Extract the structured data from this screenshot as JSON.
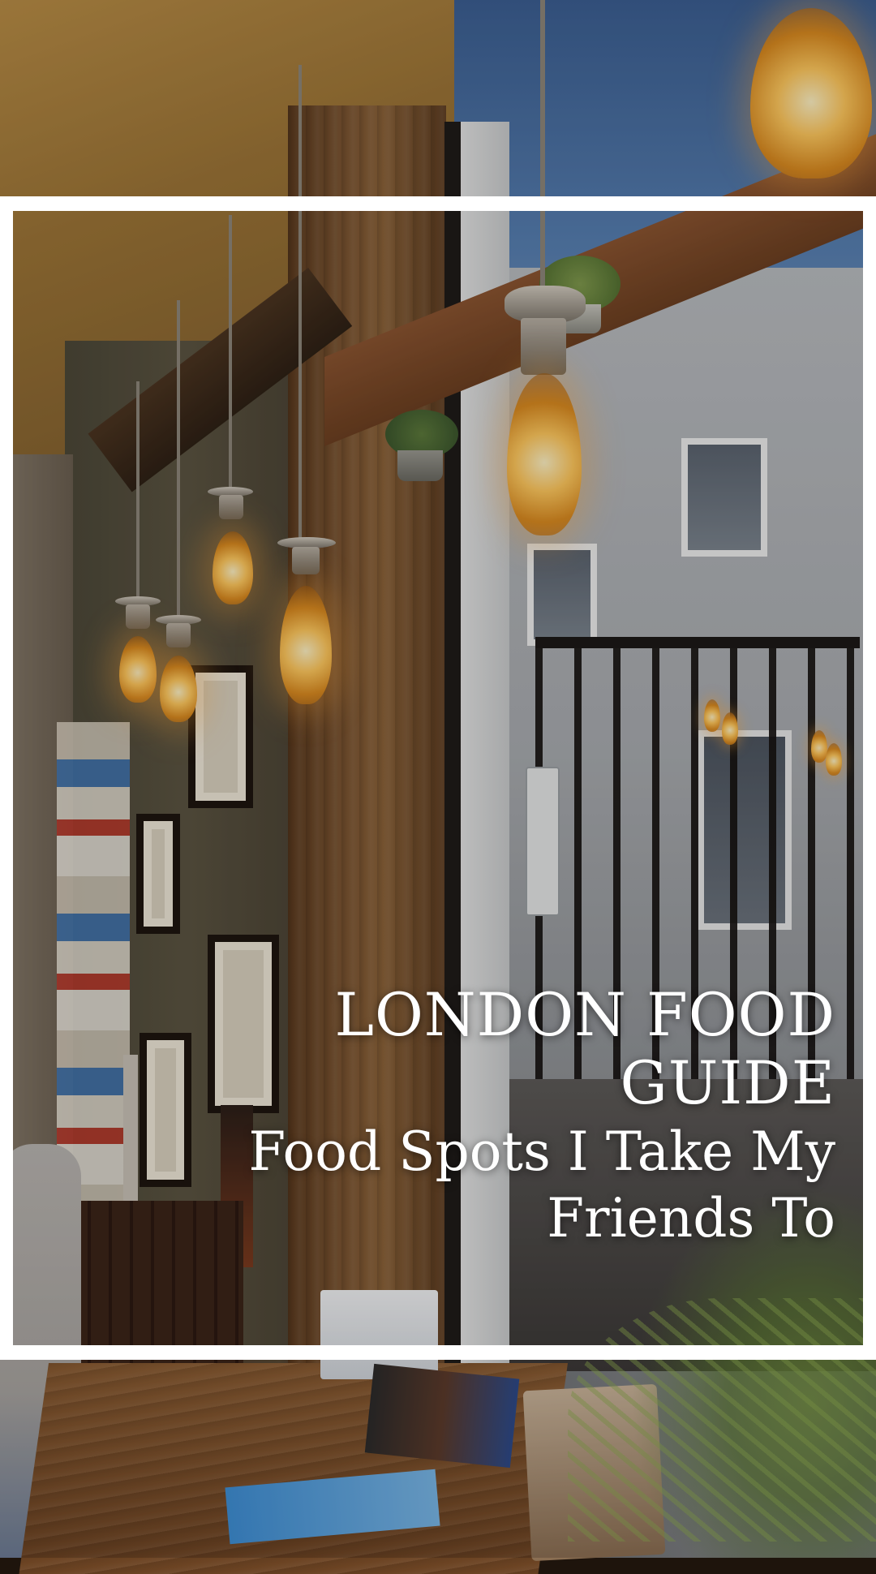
{
  "overlay": {
    "title": "LONDON FOOD GUIDE",
    "subtitle_line1": "Food Spots I Take My",
    "subtitle_line2": "Friends To"
  },
  "colors": {
    "frame": "#ffffff",
    "bulb_glow": "#ffc85c",
    "wood": "#6b4325",
    "sky": "#3f6aa0"
  },
  "scene": {
    "icons": [
      "pendant-bulb",
      "potted-plant",
      "window-railing",
      "wooden-beam",
      "picture-frame",
      "palm-leaf",
      "menu-card"
    ]
  }
}
